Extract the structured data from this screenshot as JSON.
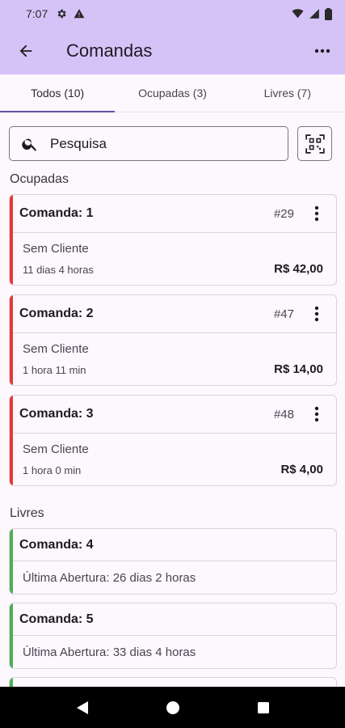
{
  "status_bar": {
    "time": "7:07"
  },
  "app_bar": {
    "title": "Comandas"
  },
  "tabs": [
    {
      "label": "Todos (10)",
      "active": true
    },
    {
      "label": "Ocupadas (3)",
      "active": false
    },
    {
      "label": "Livres (7)",
      "active": false
    }
  ],
  "search": {
    "placeholder": "Pesquisa",
    "value": ""
  },
  "sections": {
    "occupied": "Ocupadas",
    "free": "Livres"
  },
  "occupied_cards": [
    {
      "name": "Comanda: 1",
      "number": "#29",
      "client": "Sem Cliente",
      "duration": "11 dias 4 horas",
      "total": "R$ 42,00"
    },
    {
      "name": "Comanda: 2",
      "number": "#47",
      "client": "Sem Cliente",
      "duration": "1 hora 11 min",
      "total": "R$ 14,00"
    },
    {
      "name": "Comanda: 3",
      "number": "#48",
      "client": "Sem Cliente",
      "duration": "1 hora 0 min",
      "total": "R$ 4,00"
    }
  ],
  "free_cards": [
    {
      "name": "Comanda: 4",
      "last_open": "Última Abertura: 26 dias 2 horas"
    },
    {
      "name": "Comanda: 5",
      "last_open": "Última Abertura: 33 dias 4 horas"
    }
  ],
  "colors": {
    "app_bar": "#d5c3f8",
    "occupied_accent": "#e53935",
    "free_accent": "#4caf50",
    "tab_indicator": "#6750a4"
  }
}
